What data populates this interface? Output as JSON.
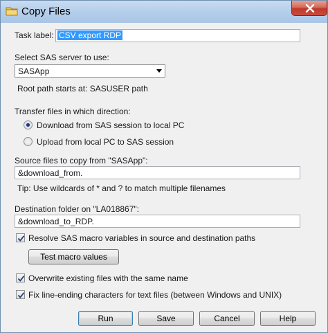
{
  "window": {
    "title": "Copy Files"
  },
  "task": {
    "label": "Task label:",
    "value": "CSV export RDP"
  },
  "server": {
    "label": "Select SAS server to use:",
    "selected": "SASApp",
    "root_path": "Root path starts at: SASUSER path"
  },
  "direction": {
    "label": "Transfer files in which direction:",
    "options": [
      {
        "label": "Download from SAS session to local PC",
        "selected": true
      },
      {
        "label": "Upload from local PC to SAS session",
        "selected": false
      }
    ]
  },
  "source": {
    "label": "Source files to copy from \"SASApp\":",
    "value": "&download_from.",
    "tip": "Tip: Use wildcards of * and ? to match multiple filenames"
  },
  "destination": {
    "label": "Destination folder on \"LA018867\":",
    "value": "&download_to_RDP."
  },
  "options": {
    "resolve_macro": {
      "label": "Resolve SAS macro variables in source and destination paths",
      "checked": true
    },
    "test_macro_button": "Test macro values",
    "overwrite": {
      "label": "Overwrite existing files with the same name",
      "checked": true
    },
    "fix_line_endings": {
      "label": "Fix line-ending characters for text files (between Windows and UNIX)",
      "checked": true
    }
  },
  "buttons": {
    "run": "Run",
    "save": "Save",
    "cancel": "Cancel",
    "help": "Help"
  },
  "colors": {
    "titlebar": "#b6cfeb",
    "close": "#c0392b",
    "selection": "#3399ff",
    "dialog": "#f0f0f0"
  }
}
